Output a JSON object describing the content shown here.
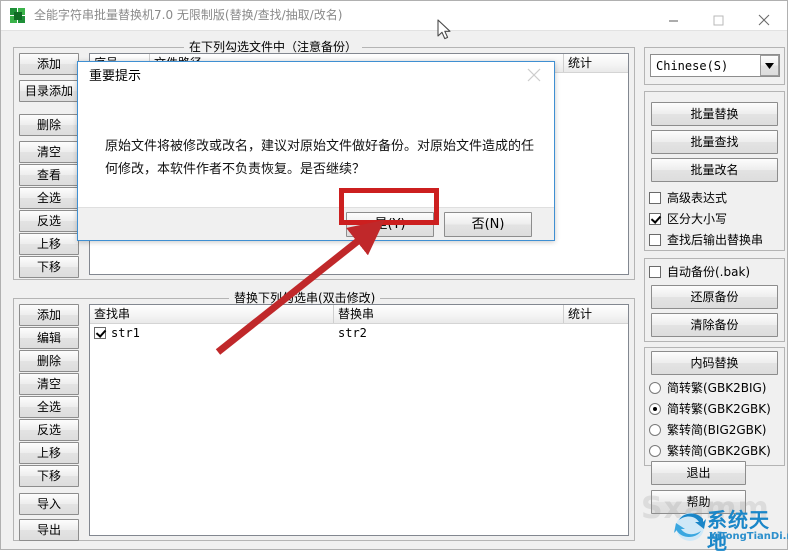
{
  "window": {
    "title": "全能字符串批量替换机7.0 无限制版(替换/查找/抽取/改名)",
    "icon": "app-icon",
    "minimize_label": "最小化",
    "maximize_label": "最大化",
    "close_label": "关闭"
  },
  "top_group": {
    "title": "在下列勾选文件中（注意备份）",
    "columns": [
      "序号",
      "文件路径",
      "统计"
    ],
    "rows": []
  },
  "bottom_group": {
    "title": "替换下列勾选串(双击修改)",
    "columns": [
      "查找串",
      "替换串",
      "统计"
    ],
    "rows": [
      {
        "checked": true,
        "find": "str1",
        "replace": "str2",
        "count": ""
      }
    ]
  },
  "left_buttons_top": [
    "添加",
    "目录添加",
    "删除",
    "清空",
    "查看",
    "全选",
    "反选",
    "上移",
    "下移"
  ],
  "left_buttons_bottom": [
    "添加",
    "编辑",
    "删除",
    "清空",
    "全选",
    "反选",
    "上移",
    "下移",
    "导入",
    "导出"
  ],
  "right_panel": {
    "language": {
      "value": "Chinese(S)",
      "arrow_icon": "chevron-down-icon"
    },
    "action_buttons": [
      "批量替换",
      "批量查找",
      "批量改名"
    ],
    "checkboxes": [
      {
        "label": "高级表达式",
        "checked": false
      },
      {
        "label": "区分大小写",
        "checked": true
      },
      {
        "label": "查找后输出替换串",
        "checked": false
      }
    ],
    "backup": {
      "checkbox": {
        "label": "自动备份(.bak)",
        "checked": false
      },
      "buttons": [
        "还原备份",
        "清除备份"
      ]
    },
    "encoding": {
      "button": "内码替换",
      "radios": [
        {
          "label": "简转繁(GBK2BIG)",
          "checked": false
        },
        {
          "label": "简转繁(GBK2GBK)",
          "checked": true
        },
        {
          "label": "繁转简(BIG2GBK)",
          "checked": false
        },
        {
          "label": "繁转简(GBK2GBK)",
          "checked": false
        }
      ]
    },
    "footer_buttons": [
      "退出",
      "帮助"
    ]
  },
  "dialog": {
    "title": "重要提示",
    "message": "原始文件将被修改或改名，建议对原始文件做好备份。对原始文件造成的任何修改，本软件作者不负责恢复。是否继续？",
    "yes_label": "是(Y)",
    "no_label": "否(N)",
    "close_label": "关闭",
    "highlight_color": "#cc1f1f"
  },
  "annotation": {
    "arrow_color": "#c0282a",
    "box_color": "#cc1f1f"
  },
  "watermark": {
    "cn": "系统天地",
    "en": "XiTongTianDi.net",
    "ghost": "Sxamm",
    "color": "#1a86c8"
  }
}
